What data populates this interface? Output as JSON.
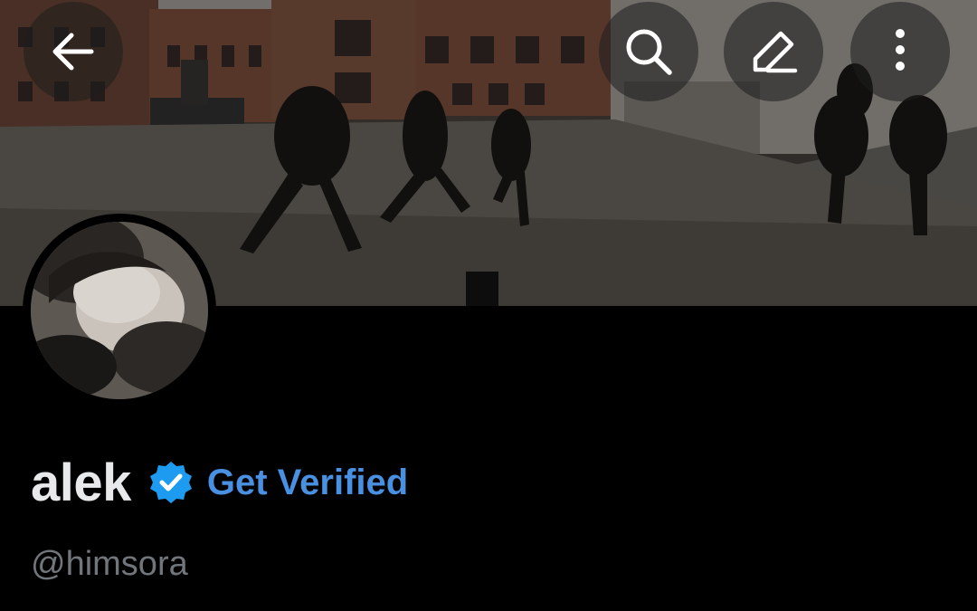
{
  "header": {
    "back_icon": "arrow-left-icon",
    "search_icon": "search-icon",
    "edit_icon": "pencil-icon",
    "more_icon": "more-vertical-icon"
  },
  "banner": {
    "description_icon": "banner-image"
  },
  "profile": {
    "display_name": "alek",
    "verified_icon": "verified-badge-icon",
    "get_verified_label": "Get Verified",
    "handle": "@himsora"
  },
  "colors": {
    "background": "#000000",
    "name": "#e7e9ea",
    "accent": "#4a90e2",
    "handle": "#71767b",
    "badge": "#1d9bf0"
  }
}
